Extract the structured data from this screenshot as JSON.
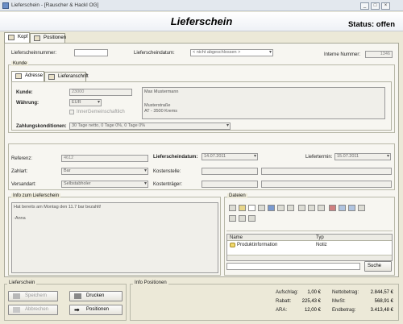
{
  "window": {
    "title": "Lieferschein - [Rauscher & Hackl OG]"
  },
  "header": {
    "title": "Lieferschein",
    "status": "Status: offen"
  },
  "tabs": [
    {
      "label": "Kopf"
    },
    {
      "label": "Positionen"
    }
  ],
  "top": {
    "lieferscheinnummer_label": "Lieferscheinnummer:",
    "lieferscheinnummer_value": "",
    "lieferscheindatum_label": "Lieferscheindatum:",
    "lieferscheindatum_value": "< nicht abgeschlossen >",
    "interne_nummer_label": "Interne Nummer:",
    "interne_nummer_value": "1346"
  },
  "kunde": {
    "group_title": "Kunde",
    "subtabs": [
      {
        "label": "Adresse"
      },
      {
        "label": "Lieferanschrift"
      }
    ],
    "kunde_label": "Kunde:",
    "kunde_value": "23000",
    "waehrung_label": "Währung:",
    "waehrung_value": "EUR",
    "innergemein_label": "InnerGemeinschaftlich",
    "zahlung_label": "Zahlungskonditionen:",
    "zahlung_value": "30 Tage netto,       0 Tage       0%,       0 Tage       0%",
    "address": [
      "Max Mustermann",
      "",
      "",
      "Musterstraße",
      "AT - 3500 Krems"
    ]
  },
  "details": {
    "referenz_label": "Referenz:",
    "referenz_value": "4612",
    "lieferscheindatum_label": "Lieferscheindatum:",
    "lieferscheindatum_value": "14.07.2011",
    "liefertermin_label": "Liefertermin:",
    "liefertermin_value": "15.07.2011",
    "zahlart_label": "Zahlart:",
    "zahlart_value": "Bar",
    "kostenstelle_label": "Kostenstelle:",
    "versandart_label": "Versandart:",
    "versandart_value": "Selbstabholer",
    "kostentraeger_label": "Kostenträger:"
  },
  "info": {
    "title": "Info zum Lieferschein",
    "lines": [
      "Hat bereits am Montag den 11.7 bar bezahlt!",
      "",
      "-Anna"
    ]
  },
  "dateien": {
    "title": "Dateien",
    "col_name": "Name",
    "col_typ": "Typ",
    "rows": [
      {
        "name": "Produktinformation",
        "typ": "Notiz"
      }
    ],
    "search_label": "Suche"
  },
  "footer": {
    "lieferschein_title": "Lieferschein",
    "buttons": {
      "speichern": "Speichern",
      "drucken": "Drucken",
      "abbrechen": "Abbrechen",
      "positionen": "Positionen"
    },
    "info_title": "Info Positionen",
    "aufschlag_label": "Aufschlag:",
    "aufschlag_value": "1,00 €",
    "rabatt_label": "Rabatt:",
    "rabatt_value": "225,43 €",
    "ara_label": "ARA:",
    "ara_value": "12,00 €",
    "netto_label": "Nettobetrag:",
    "netto_value": "2.844,57 €",
    "mwst_label": "MwSt:",
    "mwst_value": "568,91 €",
    "end_label": "Endbetrag:",
    "end_value": "3.413,48 €"
  }
}
